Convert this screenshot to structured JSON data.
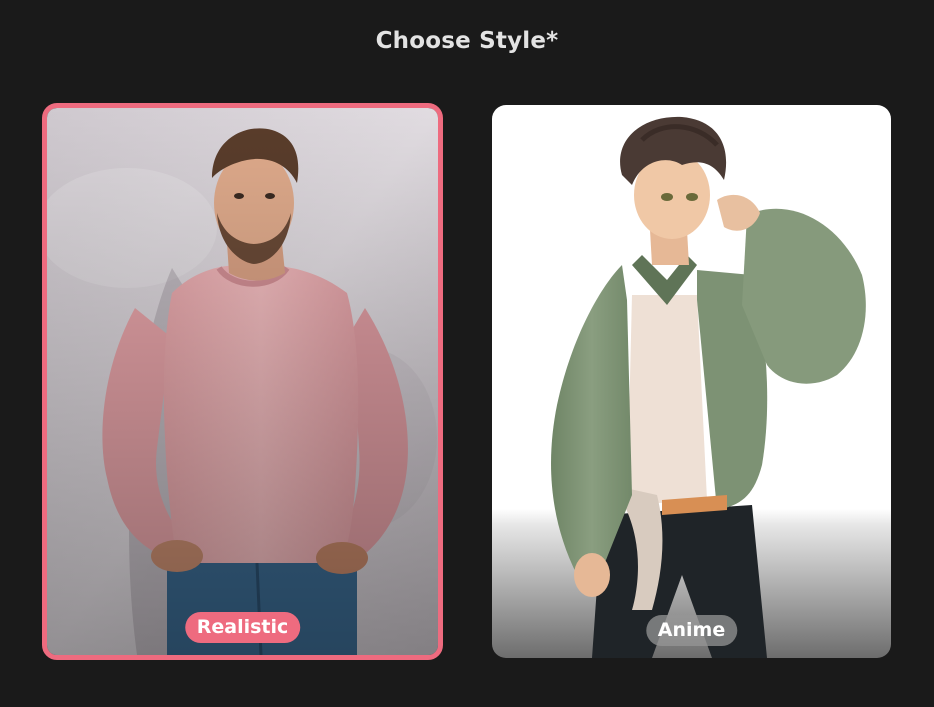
{
  "header": {
    "title": "Choose Style*"
  },
  "styles": [
    {
      "label": "Realistic",
      "selected": true,
      "image": "realistic-man-photo"
    },
    {
      "label": "Anime",
      "selected": false,
      "image": "anime-boy-illustration"
    }
  ],
  "colors": {
    "background": "#1a1a1a",
    "accent": "#ee6b7f",
    "title_text": "#e3e3e3",
    "badge_unselected": "#969696"
  }
}
